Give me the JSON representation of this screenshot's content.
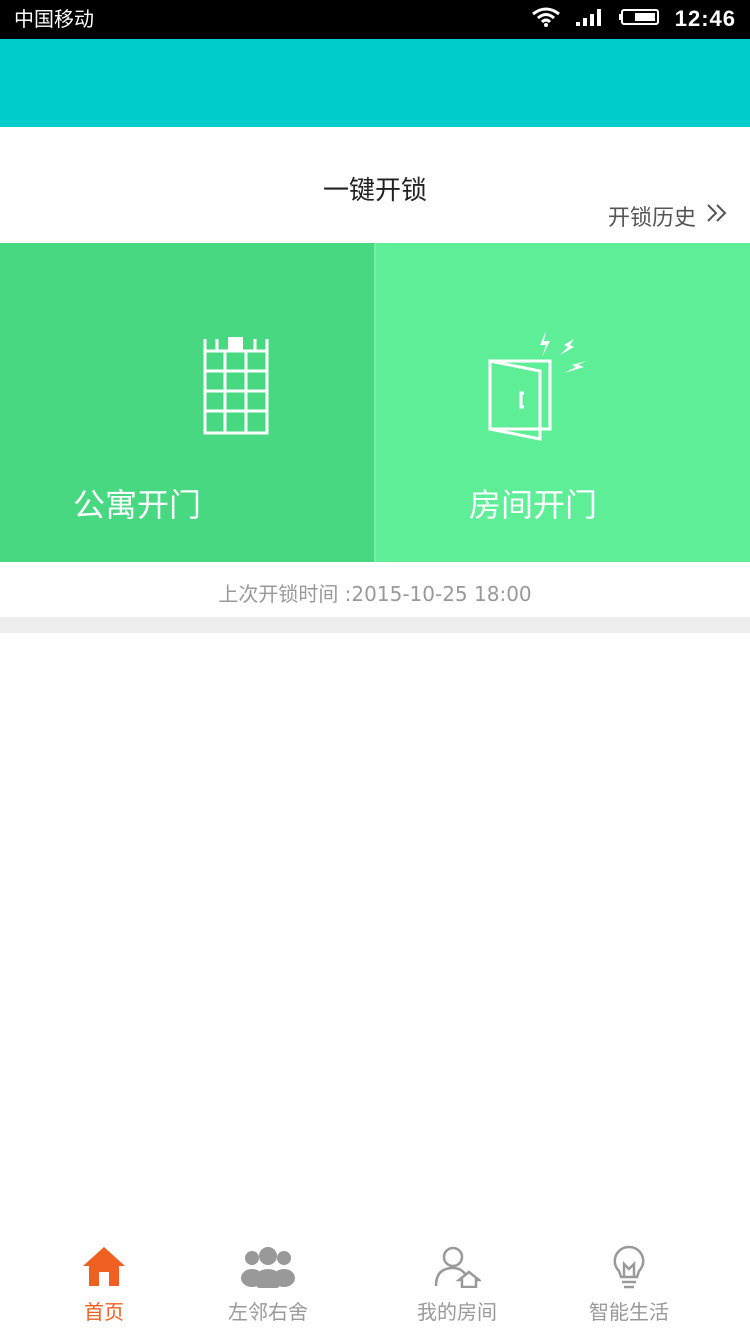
{
  "status_bar": {
    "carrier": "中国移动",
    "time": "12:46"
  },
  "unlock": {
    "title": "一键开锁",
    "history_label": "开锁历史",
    "history_chevron": "»",
    "tiles": [
      {
        "label": "公寓开门",
        "icon": "building-icon",
        "color": "#48d882"
      },
      {
        "label": "房间开门",
        "icon": "door-icon",
        "color": "#5eee97"
      }
    ],
    "last_unlock_text": "上次开锁时间 :2015-10-25 18:00"
  },
  "bottom_nav": {
    "items": [
      {
        "label": "首页",
        "icon": "home-icon",
        "active": true
      },
      {
        "label": "左邻右舍",
        "icon": "people-icon",
        "active": false
      },
      {
        "label": "我的房间",
        "icon": "user-home-icon",
        "active": false
      },
      {
        "label": "智能生活",
        "icon": "bulb-icon",
        "active": false
      }
    ]
  },
  "colors": {
    "header": "#00cccc",
    "active": "#f06022",
    "inactive": "#999999"
  }
}
